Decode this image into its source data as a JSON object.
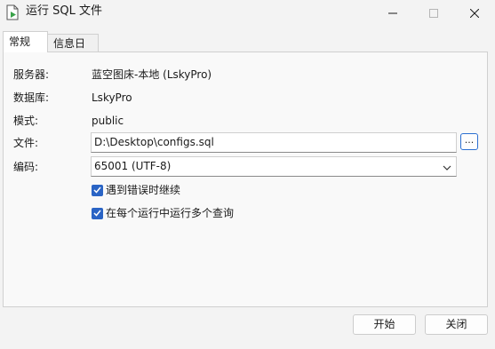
{
  "window": {
    "title": "运行 SQL 文件",
    "icon": "run-sql-file-icon"
  },
  "tabs": [
    {
      "label": "常规",
      "active": true
    },
    {
      "label": "信息日志",
      "active": false
    }
  ],
  "form": {
    "server_label": "服务器:",
    "server_value": "蓝空图床-本地 (LskyPro)",
    "database_label": "数据库:",
    "database_value": "LskyPro",
    "schema_label": "模式:",
    "schema_value": "public",
    "file_label": "文件:",
    "file_value": "D:\\Desktop\\configs.sql",
    "browse_label": "...",
    "encoding_label": "编码:",
    "encoding_value": "65001 (UTF-8)"
  },
  "options": [
    {
      "label": "遇到错误时继续",
      "checked": true
    },
    {
      "label": "在每个运行中运行多个查询",
      "checked": true
    }
  ],
  "buttons": {
    "start_label": "开始",
    "close_label": "关闭"
  },
  "colors": {
    "accent": "#2a64c5",
    "window_bg": "#f3f3f3",
    "panel_bg": "#f9f9f9"
  }
}
